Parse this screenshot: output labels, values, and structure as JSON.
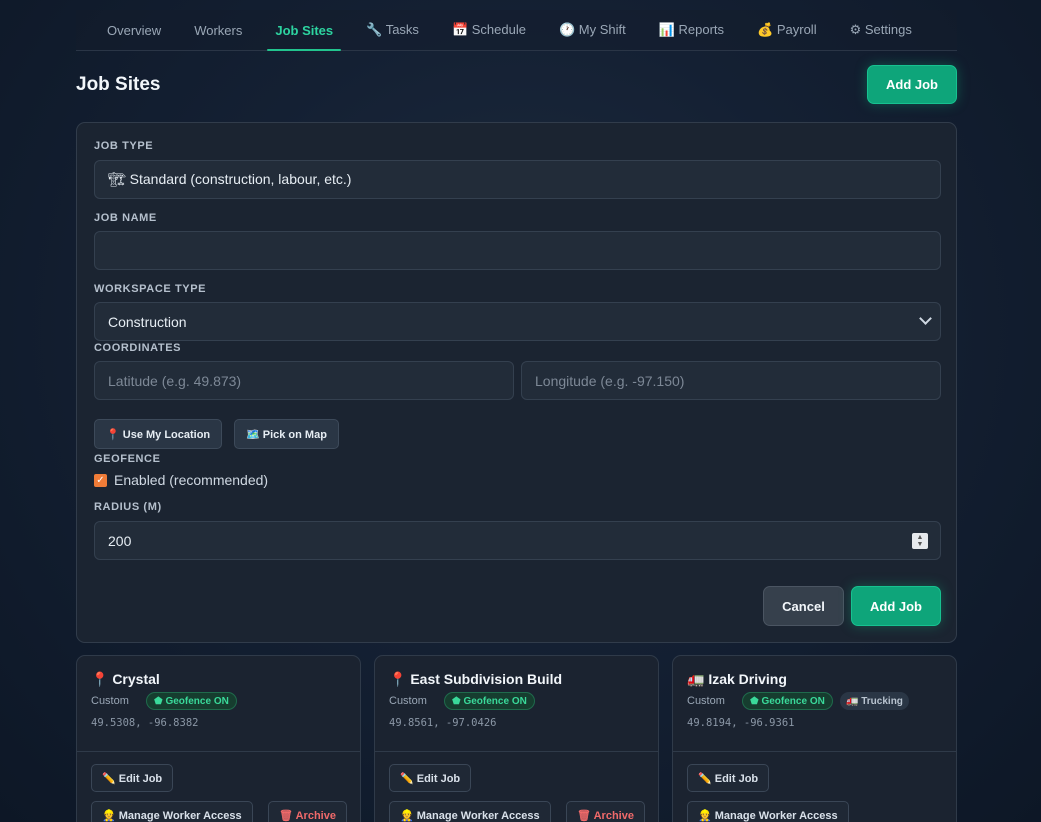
{
  "nav": {
    "tabs": [
      {
        "label": "Overview"
      },
      {
        "label": "Workers"
      },
      {
        "label": "Job Sites"
      },
      {
        "label": "🔧 Tasks"
      },
      {
        "label": "📅 Schedule"
      },
      {
        "label": "🕐 My Shift"
      },
      {
        "label": "📊 Reports"
      },
      {
        "label": "💰 Payroll"
      },
      {
        "label": "⚙ Settings"
      }
    ],
    "active": "Job Sites"
  },
  "page": {
    "title": "Job Sites",
    "add_button": "Add Job"
  },
  "form": {
    "job_type": {
      "label": "JOB TYPE",
      "value": "🏗 Standard (construction, labour, etc.)"
    },
    "job_name": {
      "label": "JOB NAME",
      "value": ""
    },
    "workspace_type": {
      "label": "WORKSPACE TYPE",
      "value": "Construction"
    },
    "coordinates": {
      "label": "COORDINATES",
      "lat_placeholder": "Latitude (e.g. 49.873)",
      "lng_placeholder": "Longitude (e.g. -97.150)"
    },
    "use_location": "📍 Use My Location",
    "pick_map": "🗺️ Pick on Map",
    "geofence": {
      "label": "GEOFENCE",
      "checkbox_label": "Enabled (recommended)",
      "checked": true
    },
    "radius": {
      "label": "RADIUS (M)",
      "value": "200"
    },
    "cancel": "Cancel",
    "submit": "Add Job"
  },
  "jobs": [
    {
      "title": "📍 Crystal",
      "type": "Custom",
      "geofence": "⬟ Geofence ON",
      "coords": "49.5308, -96.8382",
      "edit": "✏️ Edit Job",
      "access": "👷 Manage Worker Access",
      "archive": "🗑 Archive"
    },
    {
      "title": "📍 East Subdivision Build",
      "type": "Custom",
      "geofence": "⬟ Geofence ON",
      "coords": "49.8561, -97.0426",
      "edit": "✏️ Edit Job",
      "access": "👷 Manage Worker Access",
      "archive": "🗑 Archive"
    },
    {
      "title": "🚛 Izak Driving",
      "type": "Custom",
      "geofence": "⬟ Geofence ON",
      "tag": "🚛 Trucking",
      "coords": "49.8194, -96.9361",
      "edit": "✏️ Edit Job",
      "access": "👷 Manage Worker Access"
    }
  ],
  "colors": {
    "accent": "#10b981",
    "background": "#142033",
    "card": "#1b2431",
    "danger": "#f16a6a"
  }
}
